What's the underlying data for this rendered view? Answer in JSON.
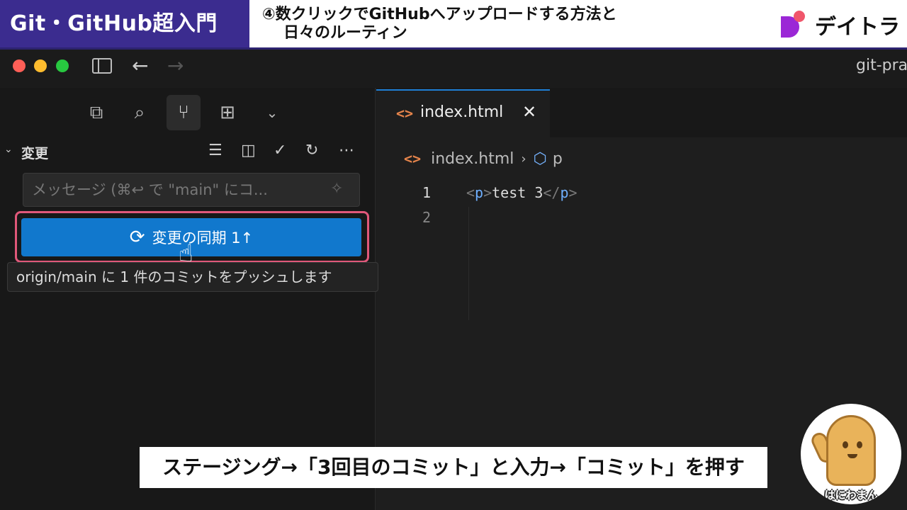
{
  "banner": {
    "series_title": "Git・GitHub超入門",
    "lesson_title_line1": "④数クリックでGitHubへアップロードする方法と",
    "lesson_title_line2": "日々のルーティン",
    "brand_name": "デイトラ"
  },
  "window": {
    "title": "git-pra"
  },
  "sidebar": {
    "activity_icons": [
      "files-icon",
      "search-icon",
      "source-control-icon",
      "extensions-icon",
      "chevron-down-icon"
    ],
    "section_title": "変更",
    "commit_message": {
      "placeholder": "メッセージ (⌘↩ で \"main\" にコ..."
    },
    "sync_button": {
      "label": "変更の同期 1↑"
    },
    "tooltip": "origin/main に 1 件のコミットをプッシュします"
  },
  "editor": {
    "tab": {
      "label": "index.html"
    },
    "breadcrumb": {
      "file": "index.html",
      "symbol": "p"
    },
    "lines": [
      {
        "number": "1",
        "open_tag": "p",
        "text": "test 3",
        "close_tag": "p"
      },
      {
        "number": "2"
      }
    ]
  },
  "subtitle": "ステージング→「3回目のコミット」と入力→「コミット」を押す",
  "mascot": {
    "label": "はにわまん"
  },
  "colors": {
    "series_bg": "#3b2c8f",
    "sync_button": "#1178cd",
    "highlight_border": "#e0587a",
    "tab_accent": "#1f7fd6",
    "html_icon": "#e5844b"
  }
}
